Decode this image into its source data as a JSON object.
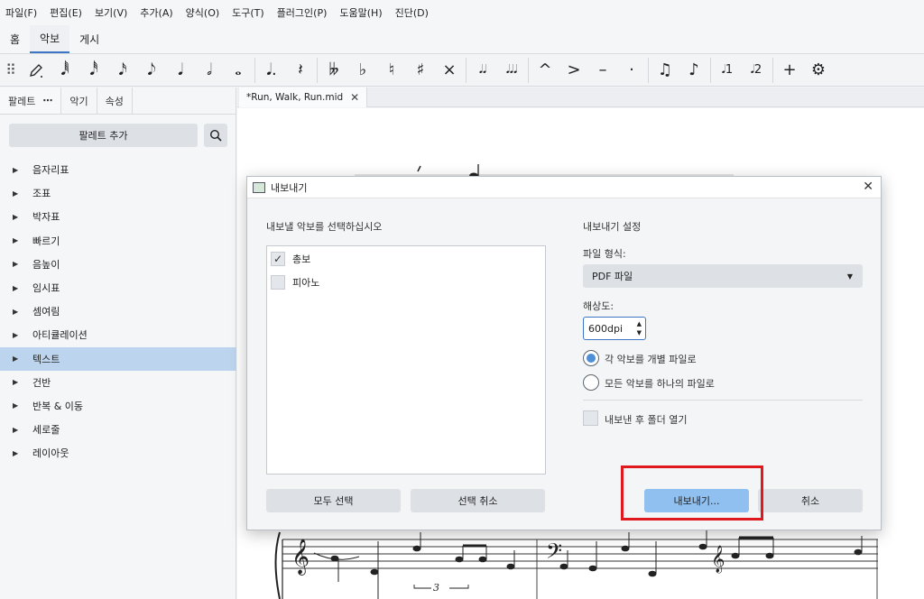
{
  "menu": [
    "파일(F)",
    "편집(E)",
    "보기(V)",
    "추가(A)",
    "양식(O)",
    "도구(T)",
    "플러그인(P)",
    "도움말(H)",
    "진단(D)"
  ],
  "workspace_tabs": [
    "홈",
    "악보",
    "게시"
  ],
  "toolbar": {
    "groups": [
      [
        "𝅘𝅥𝅱",
        "𝅘𝅥𝅰",
        "𝅘𝅥𝅯",
        "𝅘𝅥𝅮",
        "𝅘𝅥",
        "𝅗𝅥",
        "𝅝"
      ],
      [
        "𝅘𝅥.",
        "𝄽"
      ],
      [
        "𝄫",
        "♭",
        "♮",
        "♯",
        "×"
      ],
      [
        "𝅘𝅥𝅘𝅥",
        "𝅘𝅥𝅘𝅥𝅘𝅥"
      ],
      [
        "^",
        ">",
        "–",
        "·"
      ],
      [
        "♫",
        "♪"
      ],
      [
        "𝅘𝅥1",
        "𝅘𝅥2"
      ],
      [
        "+",
        "⚙"
      ]
    ]
  },
  "left_panel": {
    "tabs": [
      "팔레트",
      "악기",
      "속성"
    ],
    "tab_dots": "⋯",
    "add_palette": "팔레트 추가",
    "items": [
      "음자리표",
      "조표",
      "박자표",
      "빠르기",
      "음높이",
      "임시표",
      "셈여림",
      "아티큘레이션",
      "텍스트",
      "건반",
      "반복 & 이동",
      "세로줄",
      "레이아웃"
    ],
    "active_item": "텍스트"
  },
  "document_tab": "*Run, Walk, Run.mid",
  "dialog": {
    "title": "내보내기",
    "left_label": "내보낼 악보를 선택하십시오",
    "parts": [
      {
        "label": "총보",
        "checked": true
      },
      {
        "label": "피아노",
        "checked": false
      }
    ],
    "select_all": "모두 선택",
    "deselect": "선택 취소",
    "settings_label": "내보내기 설정",
    "format_label": "파일 형식:",
    "format_value": "PDF 파일",
    "resolution_label": "해상도:",
    "resolution_value": "600dpi",
    "radio_separate": "각 악보를 개별 파일로",
    "radio_single": "모든 악보를 하나의 파일로",
    "open_folder": "내보낸 후 폴더 열기",
    "export_button": "내보내기...",
    "cancel_button": "취소"
  },
  "score": {
    "tuplet_label": "3"
  },
  "colors": {
    "accent": "#3d76c5",
    "primary_button": "#8fc0ef",
    "highlight_box": "#e0191e",
    "active_palette_item": "#bcd4ee"
  }
}
